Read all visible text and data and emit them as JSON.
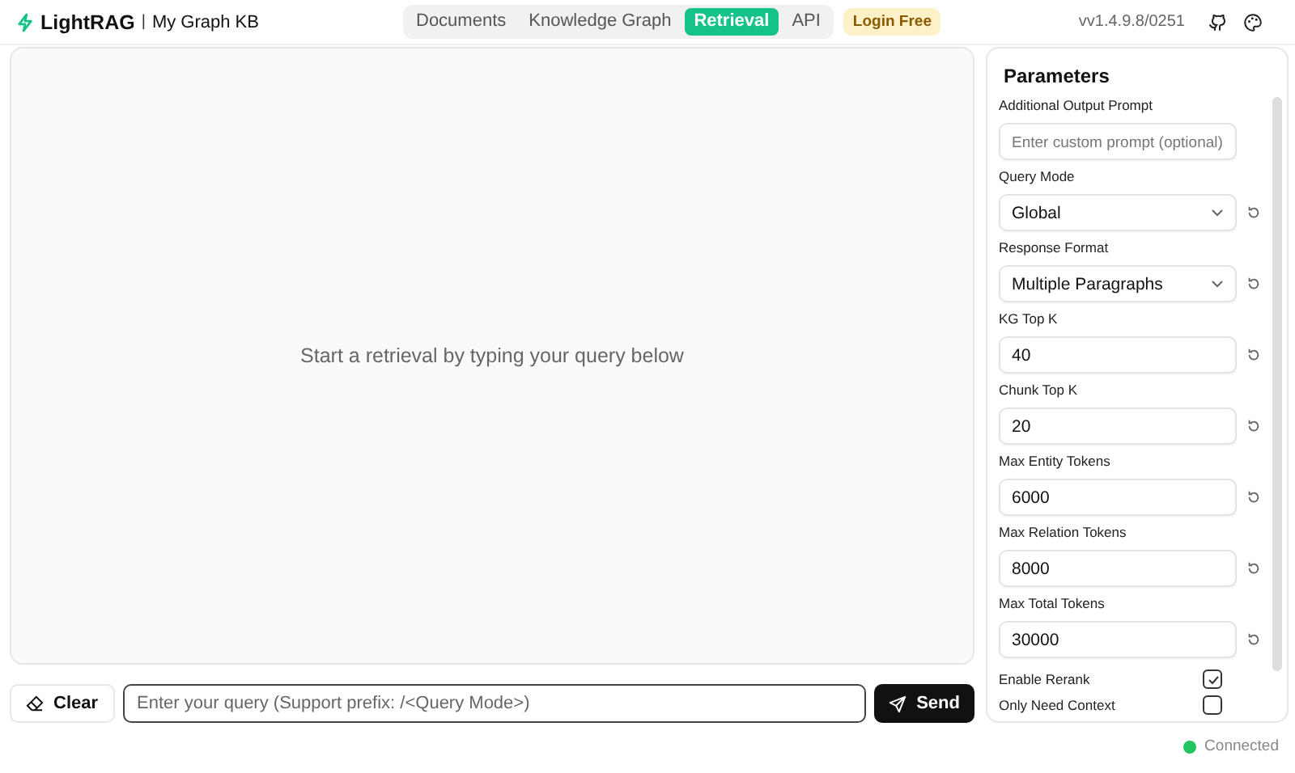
{
  "app": {
    "name": "LightRAG",
    "separator": "|",
    "kb": "My Graph KB"
  },
  "tabs": [
    {
      "label": "Documents",
      "selected": false
    },
    {
      "label": "Knowledge Graph",
      "selected": false
    },
    {
      "label": "Retrieval",
      "selected": true
    },
    {
      "label": "API",
      "selected": false
    }
  ],
  "login": "Login Free",
  "version": "vv1.4.9.8/0251",
  "chat": {
    "empty_message": "Start a retrieval by typing your query below"
  },
  "input_bar": {
    "clear": "Clear",
    "placeholder": "Enter your query (Support prefix: /<Query Mode>)",
    "send": "Send"
  },
  "parameters": {
    "title": "Parameters",
    "items": [
      {
        "kind": "text",
        "label": "Additional Output Prompt",
        "placeholder": "Enter custom prompt (optional)"
      },
      {
        "kind": "select",
        "label": "Query Mode",
        "value": "Global"
      },
      {
        "kind": "select",
        "label": "Response Format",
        "value": "Multiple Paragraphs"
      },
      {
        "kind": "number",
        "label": "KG Top K",
        "value": "40"
      },
      {
        "kind": "number",
        "label": "Chunk Top K",
        "value": "20"
      },
      {
        "kind": "number",
        "label": "Max Entity Tokens",
        "value": "6000"
      },
      {
        "kind": "number",
        "label": "Max Relation Tokens",
        "value": "8000"
      },
      {
        "kind": "number",
        "label": "Max Total Tokens",
        "value": "30000"
      },
      {
        "kind": "checkbox",
        "label": "Enable Rerank",
        "checked": true
      },
      {
        "kind": "checkbox",
        "label": "Only Need Context",
        "checked": false
      }
    ]
  },
  "status": {
    "label": "Connected",
    "connected": true
  }
}
